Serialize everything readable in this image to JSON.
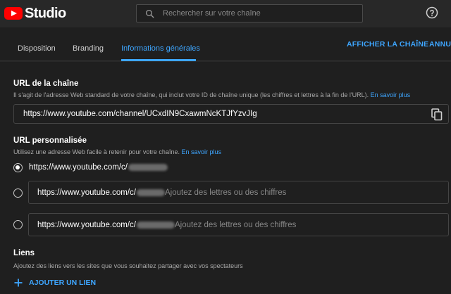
{
  "header": {
    "logo_text": "Studio",
    "search_placeholder": "Rechercher sur votre chaîne"
  },
  "tabs": [
    {
      "label": "Disposition",
      "active": false
    },
    {
      "label": "Branding",
      "active": false
    },
    {
      "label": "Informations générales",
      "active": true
    }
  ],
  "actions": {
    "view_channel": "AFFICHER LA CHAÎNE",
    "cancel": "ANNUL"
  },
  "channel_url": {
    "title": "URL de la chaîne",
    "description": "Il s'agit de l'adresse Web standard de votre chaîne, qui inclut votre ID de chaîne unique (les chiffres et lettres à la fin de l'URL).",
    "learn_more": "En savoir plus",
    "value": "https://www.youtube.com/channel/UCxdIN9CxawmNcKTJfYzvJIg"
  },
  "custom_url": {
    "title": "URL personnalisée",
    "description": "Utilisez une adresse Web facile à retenir pour votre chaîne.",
    "learn_more": "En savoir plus",
    "prefix": "https://www.youtube.com/c/",
    "suffix_placeholder": "Ajoutez des lettres ou des chiffres",
    "selected_index": 0
  },
  "links": {
    "title": "Liens",
    "description": "Ajoutez des liens vers les sites que vous souhaitez partager avec vos spectateurs",
    "add_label": "AJOUTER UN LIEN"
  },
  "colors": {
    "accent": "#3ea6ff",
    "brand": "#ff0000",
    "background": "#1f1f1f"
  }
}
